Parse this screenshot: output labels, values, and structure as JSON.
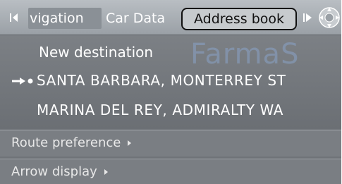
{
  "tabs": {
    "navigation": "vigation",
    "car_data": "Car Data",
    "address_book": "Address book"
  },
  "watermark": "FarmaS",
  "list": {
    "new_destination": "New destination",
    "item1": "SANTA BARBARA, MONTERREY ST",
    "item2": "MARINA DEL REY, ADMIRALTY WA"
  },
  "options": {
    "route_preference": "Route preference",
    "arrow_display": "Arrow display"
  }
}
